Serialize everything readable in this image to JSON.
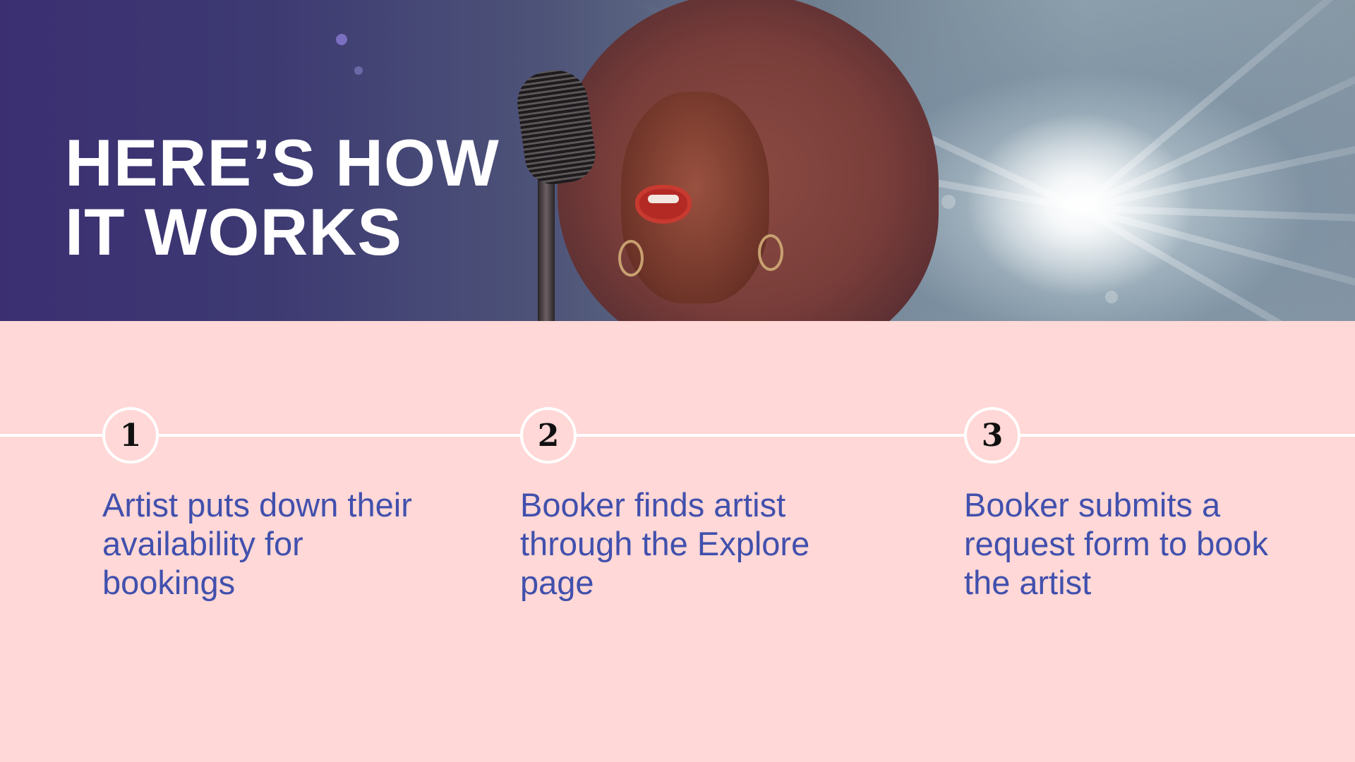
{
  "hero": {
    "title": "HERE’S HOW\nIT WORKS"
  },
  "steps": [
    {
      "number": "1",
      "text": "Artist puts down their availability for bookings"
    },
    {
      "number": "2",
      "text": "Booker finds artist through the Explore page"
    },
    {
      "number": "3",
      "text": "Booker submits a request form to book the artist"
    }
  ],
  "colors": {
    "background": "#ffd8d7",
    "step_text": "#4150ad",
    "title": "#ffffff",
    "timeline": "#ffffff"
  }
}
